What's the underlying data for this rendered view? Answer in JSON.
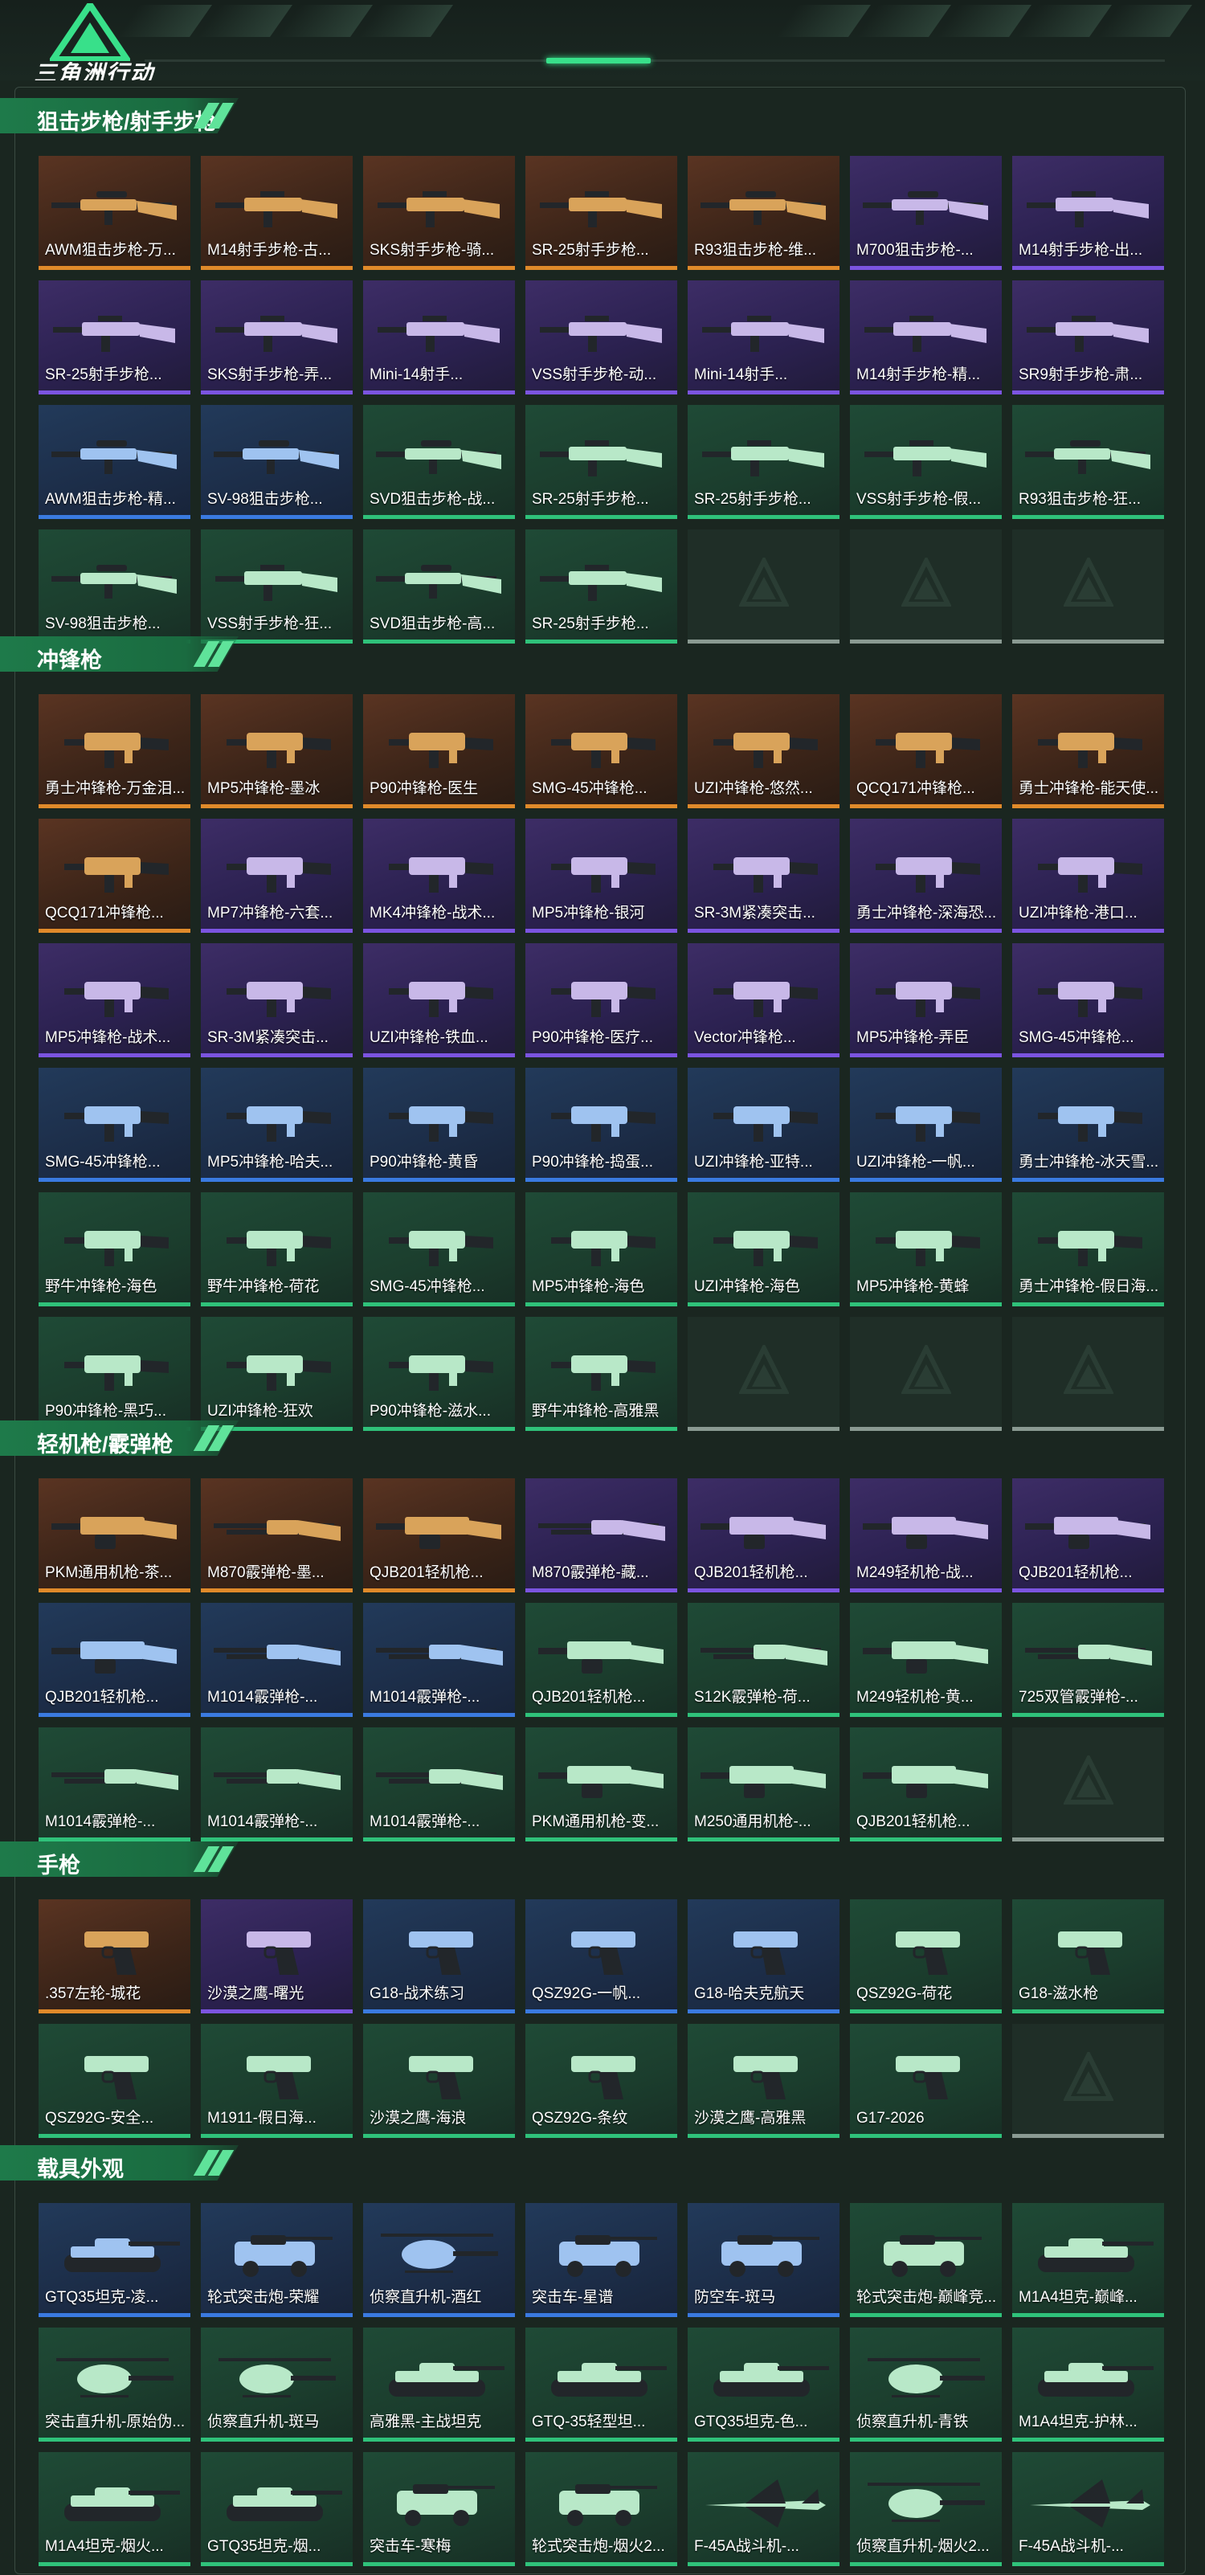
{
  "logo": {
    "text": "三角洲行动"
  },
  "colors": {
    "orange": "#e08a2a",
    "purple": "#7b54e0",
    "blue": "#3a7ae0",
    "green": "#2fc27a",
    "accent": "#38e08a"
  },
  "sections": [
    {
      "title": "狙击步枪/射手步枪",
      "items": [
        {
          "label": "AWM狙击步枪-万...",
          "rarity": "orange",
          "icon": "sniper-rifle-icon"
        },
        {
          "label": "M14射手步枪-古...",
          "rarity": "orange",
          "icon": "rifle-icon"
        },
        {
          "label": "SKS射手步枪-骑...",
          "rarity": "orange",
          "icon": "rifle-icon"
        },
        {
          "label": "SR-25射手步枪...",
          "rarity": "orange",
          "icon": "rifle-icon"
        },
        {
          "label": "R93狙击步枪-维...",
          "rarity": "orange",
          "icon": "sniper-rifle-icon"
        },
        {
          "label": "M700狙击步枪-...",
          "rarity": "purple",
          "icon": "sniper-rifle-icon"
        },
        {
          "label": "M14射手步枪-出...",
          "rarity": "purple",
          "icon": "rifle-icon"
        },
        {
          "label": "SR-25射手步枪...",
          "rarity": "purple",
          "icon": "rifle-icon"
        },
        {
          "label": "SKS射手步枪-弄...",
          "rarity": "purple",
          "icon": "rifle-icon"
        },
        {
          "label": "Mini-14射手...",
          "rarity": "purple",
          "icon": "rifle-icon"
        },
        {
          "label": "VSS射手步枪-动...",
          "rarity": "purple",
          "icon": "rifle-icon"
        },
        {
          "label": "Mini-14射手...",
          "rarity": "purple",
          "icon": "rifle-icon"
        },
        {
          "label": "M14射手步枪-精...",
          "rarity": "purple",
          "icon": "rifle-icon"
        },
        {
          "label": "SR9射手步枪-肃...",
          "rarity": "purple",
          "icon": "rifle-icon"
        },
        {
          "label": "AWM狙击步枪-精...",
          "rarity": "blue",
          "icon": "sniper-rifle-icon"
        },
        {
          "label": "SV-98狙击步枪...",
          "rarity": "blue",
          "icon": "sniper-rifle-icon"
        },
        {
          "label": "SVD狙击步枪-战...",
          "rarity": "green",
          "icon": "sniper-rifle-icon"
        },
        {
          "label": "SR-25射手步枪...",
          "rarity": "green",
          "icon": "rifle-icon"
        },
        {
          "label": "SR-25射手步枪...",
          "rarity": "green",
          "icon": "rifle-icon"
        },
        {
          "label": "VSS射手步枪-假...",
          "rarity": "green",
          "icon": "rifle-icon"
        },
        {
          "label": "R93狙击步枪-狂...",
          "rarity": "green",
          "icon": "sniper-rifle-icon"
        },
        {
          "label": "SV-98狙击步枪...",
          "rarity": "green",
          "icon": "sniper-rifle-icon"
        },
        {
          "label": "VSS射手步枪-狂...",
          "rarity": "green",
          "icon": "rifle-icon"
        },
        {
          "label": "SVD狙击步枪-高...",
          "rarity": "green",
          "icon": "sniper-rifle-icon"
        },
        {
          "label": "SR-25射手步枪...",
          "rarity": "green",
          "icon": "rifle-icon"
        },
        {
          "label": "",
          "rarity": "empty",
          "icon": "empty-slot-icon"
        },
        {
          "label": "",
          "rarity": "empty",
          "icon": "empty-slot-icon"
        },
        {
          "label": "",
          "rarity": "empty",
          "icon": "empty-slot-icon"
        }
      ]
    },
    {
      "title": "冲锋枪",
      "items": [
        {
          "label": "勇士冲锋枪-万金泪...",
          "rarity": "orange",
          "icon": "smg-icon"
        },
        {
          "label": "MP5冲锋枪-墨冰",
          "rarity": "orange",
          "icon": "smg-icon"
        },
        {
          "label": "P90冲锋枪-医生",
          "rarity": "orange",
          "icon": "smg-icon"
        },
        {
          "label": "SMG-45冲锋枪...",
          "rarity": "orange",
          "icon": "smg-icon"
        },
        {
          "label": "UZI冲锋枪-悠然...",
          "rarity": "orange",
          "icon": "smg-icon"
        },
        {
          "label": "QCQ171冲锋枪...",
          "rarity": "orange",
          "icon": "smg-icon"
        },
        {
          "label": "勇士冲锋枪-能天使...",
          "rarity": "orange",
          "icon": "smg-icon"
        },
        {
          "label": "QCQ171冲锋枪...",
          "rarity": "orange",
          "icon": "smg-icon"
        },
        {
          "label": "MP7冲锋枪-六套...",
          "rarity": "purple",
          "icon": "smg-icon"
        },
        {
          "label": "MK4冲锋枪-战术...",
          "rarity": "purple",
          "icon": "smg-icon"
        },
        {
          "label": "MP5冲锋枪-银河",
          "rarity": "purple",
          "icon": "smg-icon"
        },
        {
          "label": "SR-3M紧凑突击...",
          "rarity": "purple",
          "icon": "smg-icon"
        },
        {
          "label": "勇士冲锋枪-深海恐...",
          "rarity": "purple",
          "icon": "smg-icon"
        },
        {
          "label": "UZI冲锋枪-港口...",
          "rarity": "purple",
          "icon": "smg-icon"
        },
        {
          "label": "MP5冲锋枪-战术...",
          "rarity": "purple",
          "icon": "smg-icon"
        },
        {
          "label": "SR-3M紧凑突击...",
          "rarity": "purple",
          "icon": "smg-icon"
        },
        {
          "label": "UZI冲锋枪-铁血...",
          "rarity": "purple",
          "icon": "smg-icon"
        },
        {
          "label": "P90冲锋枪-医疗...",
          "rarity": "purple",
          "icon": "smg-icon"
        },
        {
          "label": "Vector冲锋枪...",
          "rarity": "purple",
          "icon": "smg-icon"
        },
        {
          "label": "MP5冲锋枪-弄臣",
          "rarity": "purple",
          "icon": "smg-icon"
        },
        {
          "label": "SMG-45冲锋枪...",
          "rarity": "purple",
          "icon": "smg-icon"
        },
        {
          "label": "SMG-45冲锋枪...",
          "rarity": "blue",
          "icon": "smg-icon"
        },
        {
          "label": "MP5冲锋枪-哈夫...",
          "rarity": "blue",
          "icon": "smg-icon"
        },
        {
          "label": "P90冲锋枪-黄昏",
          "rarity": "blue",
          "icon": "smg-icon"
        },
        {
          "label": "P90冲锋枪-捣蛋...",
          "rarity": "blue",
          "icon": "smg-icon"
        },
        {
          "label": "UZI冲锋枪-亚特...",
          "rarity": "blue",
          "icon": "smg-icon"
        },
        {
          "label": "UZI冲锋枪-一帆...",
          "rarity": "blue",
          "icon": "smg-icon"
        },
        {
          "label": "勇士冲锋枪-冰天雪...",
          "rarity": "blue",
          "icon": "smg-icon"
        },
        {
          "label": "野牛冲锋枪-海色",
          "rarity": "green",
          "icon": "smg-icon"
        },
        {
          "label": "野牛冲锋枪-荷花",
          "rarity": "green",
          "icon": "smg-icon"
        },
        {
          "label": "SMG-45冲锋枪...",
          "rarity": "green",
          "icon": "smg-icon"
        },
        {
          "label": "MP5冲锋枪-海色",
          "rarity": "green",
          "icon": "smg-icon"
        },
        {
          "label": "UZI冲锋枪-海色",
          "rarity": "green",
          "icon": "smg-icon"
        },
        {
          "label": "MP5冲锋枪-黄蜂",
          "rarity": "green",
          "icon": "smg-icon"
        },
        {
          "label": "勇士冲锋枪-假日海...",
          "rarity": "green",
          "icon": "smg-icon"
        },
        {
          "label": "P90冲锋枪-黑巧...",
          "rarity": "green",
          "icon": "smg-icon"
        },
        {
          "label": "UZI冲锋枪-狂欢",
          "rarity": "green",
          "icon": "smg-icon"
        },
        {
          "label": "P90冲锋枪-滋水...",
          "rarity": "green",
          "icon": "smg-icon"
        },
        {
          "label": "野牛冲锋枪-高雅黑",
          "rarity": "green",
          "icon": "smg-icon"
        },
        {
          "label": "",
          "rarity": "empty",
          "icon": "empty-slot-icon"
        },
        {
          "label": "",
          "rarity": "empty",
          "icon": "empty-slot-icon"
        },
        {
          "label": "",
          "rarity": "empty",
          "icon": "empty-slot-icon"
        }
      ]
    },
    {
      "title": "轻机枪/霰弹枪",
      "items": [
        {
          "label": "PKM通用机枪-茶...",
          "rarity": "orange",
          "icon": "lmg-icon"
        },
        {
          "label": "M870霰弹枪-墨...",
          "rarity": "orange",
          "icon": "shotgun-icon"
        },
        {
          "label": "QJB201轻机枪...",
          "rarity": "orange",
          "icon": "lmg-icon"
        },
        {
          "label": "M870霰弹枪-藏...",
          "rarity": "purple",
          "icon": "shotgun-icon"
        },
        {
          "label": "QJB201轻机枪...",
          "rarity": "purple",
          "icon": "lmg-icon"
        },
        {
          "label": "M249轻机枪-战...",
          "rarity": "purple",
          "icon": "lmg-icon"
        },
        {
          "label": "QJB201轻机枪...",
          "rarity": "purple",
          "icon": "lmg-icon"
        },
        {
          "label": "QJB201轻机枪...",
          "rarity": "blue",
          "icon": "lmg-icon"
        },
        {
          "label": "M1014霰弹枪-...",
          "rarity": "blue",
          "icon": "shotgun-icon"
        },
        {
          "label": "M1014霰弹枪-...",
          "rarity": "blue",
          "icon": "shotgun-icon"
        },
        {
          "label": "QJB201轻机枪...",
          "rarity": "green",
          "icon": "lmg-icon"
        },
        {
          "label": "S12K霰弹枪-荷...",
          "rarity": "green",
          "icon": "shotgun-icon"
        },
        {
          "label": "M249轻机枪-黄...",
          "rarity": "green",
          "icon": "lmg-icon"
        },
        {
          "label": "725双管霰弹枪-...",
          "rarity": "green",
          "icon": "shotgun-icon"
        },
        {
          "label": "M1014霰弹枪-...",
          "rarity": "green",
          "icon": "shotgun-icon"
        },
        {
          "label": "M1014霰弹枪-...",
          "rarity": "green",
          "icon": "shotgun-icon"
        },
        {
          "label": "M1014霰弹枪-...",
          "rarity": "green",
          "icon": "shotgun-icon"
        },
        {
          "label": "PKM通用机枪-变...",
          "rarity": "green",
          "icon": "lmg-icon"
        },
        {
          "label": "M250通用机枪-...",
          "rarity": "green",
          "icon": "lmg-icon"
        },
        {
          "label": "QJB201轻机枪...",
          "rarity": "green",
          "icon": "lmg-icon"
        },
        {
          "label": "",
          "rarity": "empty",
          "icon": "empty-slot-icon"
        }
      ]
    },
    {
      "title": "手枪",
      "items": [
        {
          "label": ".357左轮-城花",
          "rarity": "orange",
          "icon": "revolver-icon"
        },
        {
          "label": "沙漠之鹰-曙光",
          "rarity": "purple",
          "icon": "pistol-icon"
        },
        {
          "label": "G18-战术练习",
          "rarity": "blue",
          "icon": "pistol-icon"
        },
        {
          "label": "QSZ92G-一帆...",
          "rarity": "blue",
          "icon": "pistol-icon"
        },
        {
          "label": "G18-哈夫克航天",
          "rarity": "blue",
          "icon": "pistol-icon"
        },
        {
          "label": "QSZ92G-荷花",
          "rarity": "green",
          "icon": "pistol-icon"
        },
        {
          "label": "G18-滋水枪",
          "rarity": "green",
          "icon": "pistol-icon"
        },
        {
          "label": "QSZ92G-安全...",
          "rarity": "green",
          "icon": "pistol-icon"
        },
        {
          "label": "M1911-假日海...",
          "rarity": "green",
          "icon": "pistol-icon"
        },
        {
          "label": "沙漠之鹰-海浪",
          "rarity": "green",
          "icon": "pistol-icon"
        },
        {
          "label": "QSZ92G-条纹",
          "rarity": "green",
          "icon": "pistol-icon"
        },
        {
          "label": "沙漠之鹰-高雅黑",
          "rarity": "green",
          "icon": "pistol-icon"
        },
        {
          "label": "G17-2026",
          "rarity": "green",
          "icon": "pistol-icon"
        },
        {
          "label": "",
          "rarity": "empty",
          "icon": "empty-slot-icon"
        }
      ]
    },
    {
      "title": "载具外观",
      "items": [
        {
          "label": "GTQ35坦克-凌...",
          "rarity": "blue",
          "icon": "tank-icon"
        },
        {
          "label": "轮式突击炮-荣耀",
          "rarity": "blue",
          "icon": "armored-car-icon"
        },
        {
          "label": "侦察直升机-酒红",
          "rarity": "blue",
          "icon": "helicopter-icon"
        },
        {
          "label": "突击车-星谱",
          "rarity": "blue",
          "icon": "armored-car-icon"
        },
        {
          "label": "防空车-斑马",
          "rarity": "blue",
          "icon": "armored-car-icon"
        },
        {
          "label": "轮式突击炮-巅峰竞...",
          "rarity": "green",
          "icon": "armored-car-icon"
        },
        {
          "label": "M1A4坦克-巅峰...",
          "rarity": "green",
          "icon": "tank-icon"
        },
        {
          "label": "突击直升机-原始伪...",
          "rarity": "green",
          "icon": "helicopter-icon"
        },
        {
          "label": "侦察直升机-斑马",
          "rarity": "green",
          "icon": "helicopter-icon"
        },
        {
          "label": "高雅黑-主战坦克",
          "rarity": "green",
          "icon": "tank-icon"
        },
        {
          "label": "GTQ-35轻型坦...",
          "rarity": "green",
          "icon": "tank-icon"
        },
        {
          "label": "GTQ35坦克-色...",
          "rarity": "green",
          "icon": "tank-icon"
        },
        {
          "label": "侦察直升机-青铁",
          "rarity": "green",
          "icon": "helicopter-icon"
        },
        {
          "label": "M1A4坦克-护林...",
          "rarity": "green",
          "icon": "tank-icon"
        },
        {
          "label": "M1A4坦克-烟火...",
          "rarity": "green",
          "icon": "tank-icon"
        },
        {
          "label": "GTQ35坦克-烟...",
          "rarity": "green",
          "icon": "tank-icon"
        },
        {
          "label": "突击车-寒梅",
          "rarity": "green",
          "icon": "armored-car-icon"
        },
        {
          "label": "轮式突击炮-烟火2...",
          "rarity": "green",
          "icon": "armored-car-icon"
        },
        {
          "label": "F-45A战斗机-...",
          "rarity": "green",
          "icon": "jet-icon"
        },
        {
          "label": "侦察直升机-烟火2...",
          "rarity": "green",
          "icon": "helicopter-icon"
        },
        {
          "label": "F-45A战斗机-...",
          "rarity": "green",
          "icon": "jet-icon"
        }
      ]
    }
  ]
}
